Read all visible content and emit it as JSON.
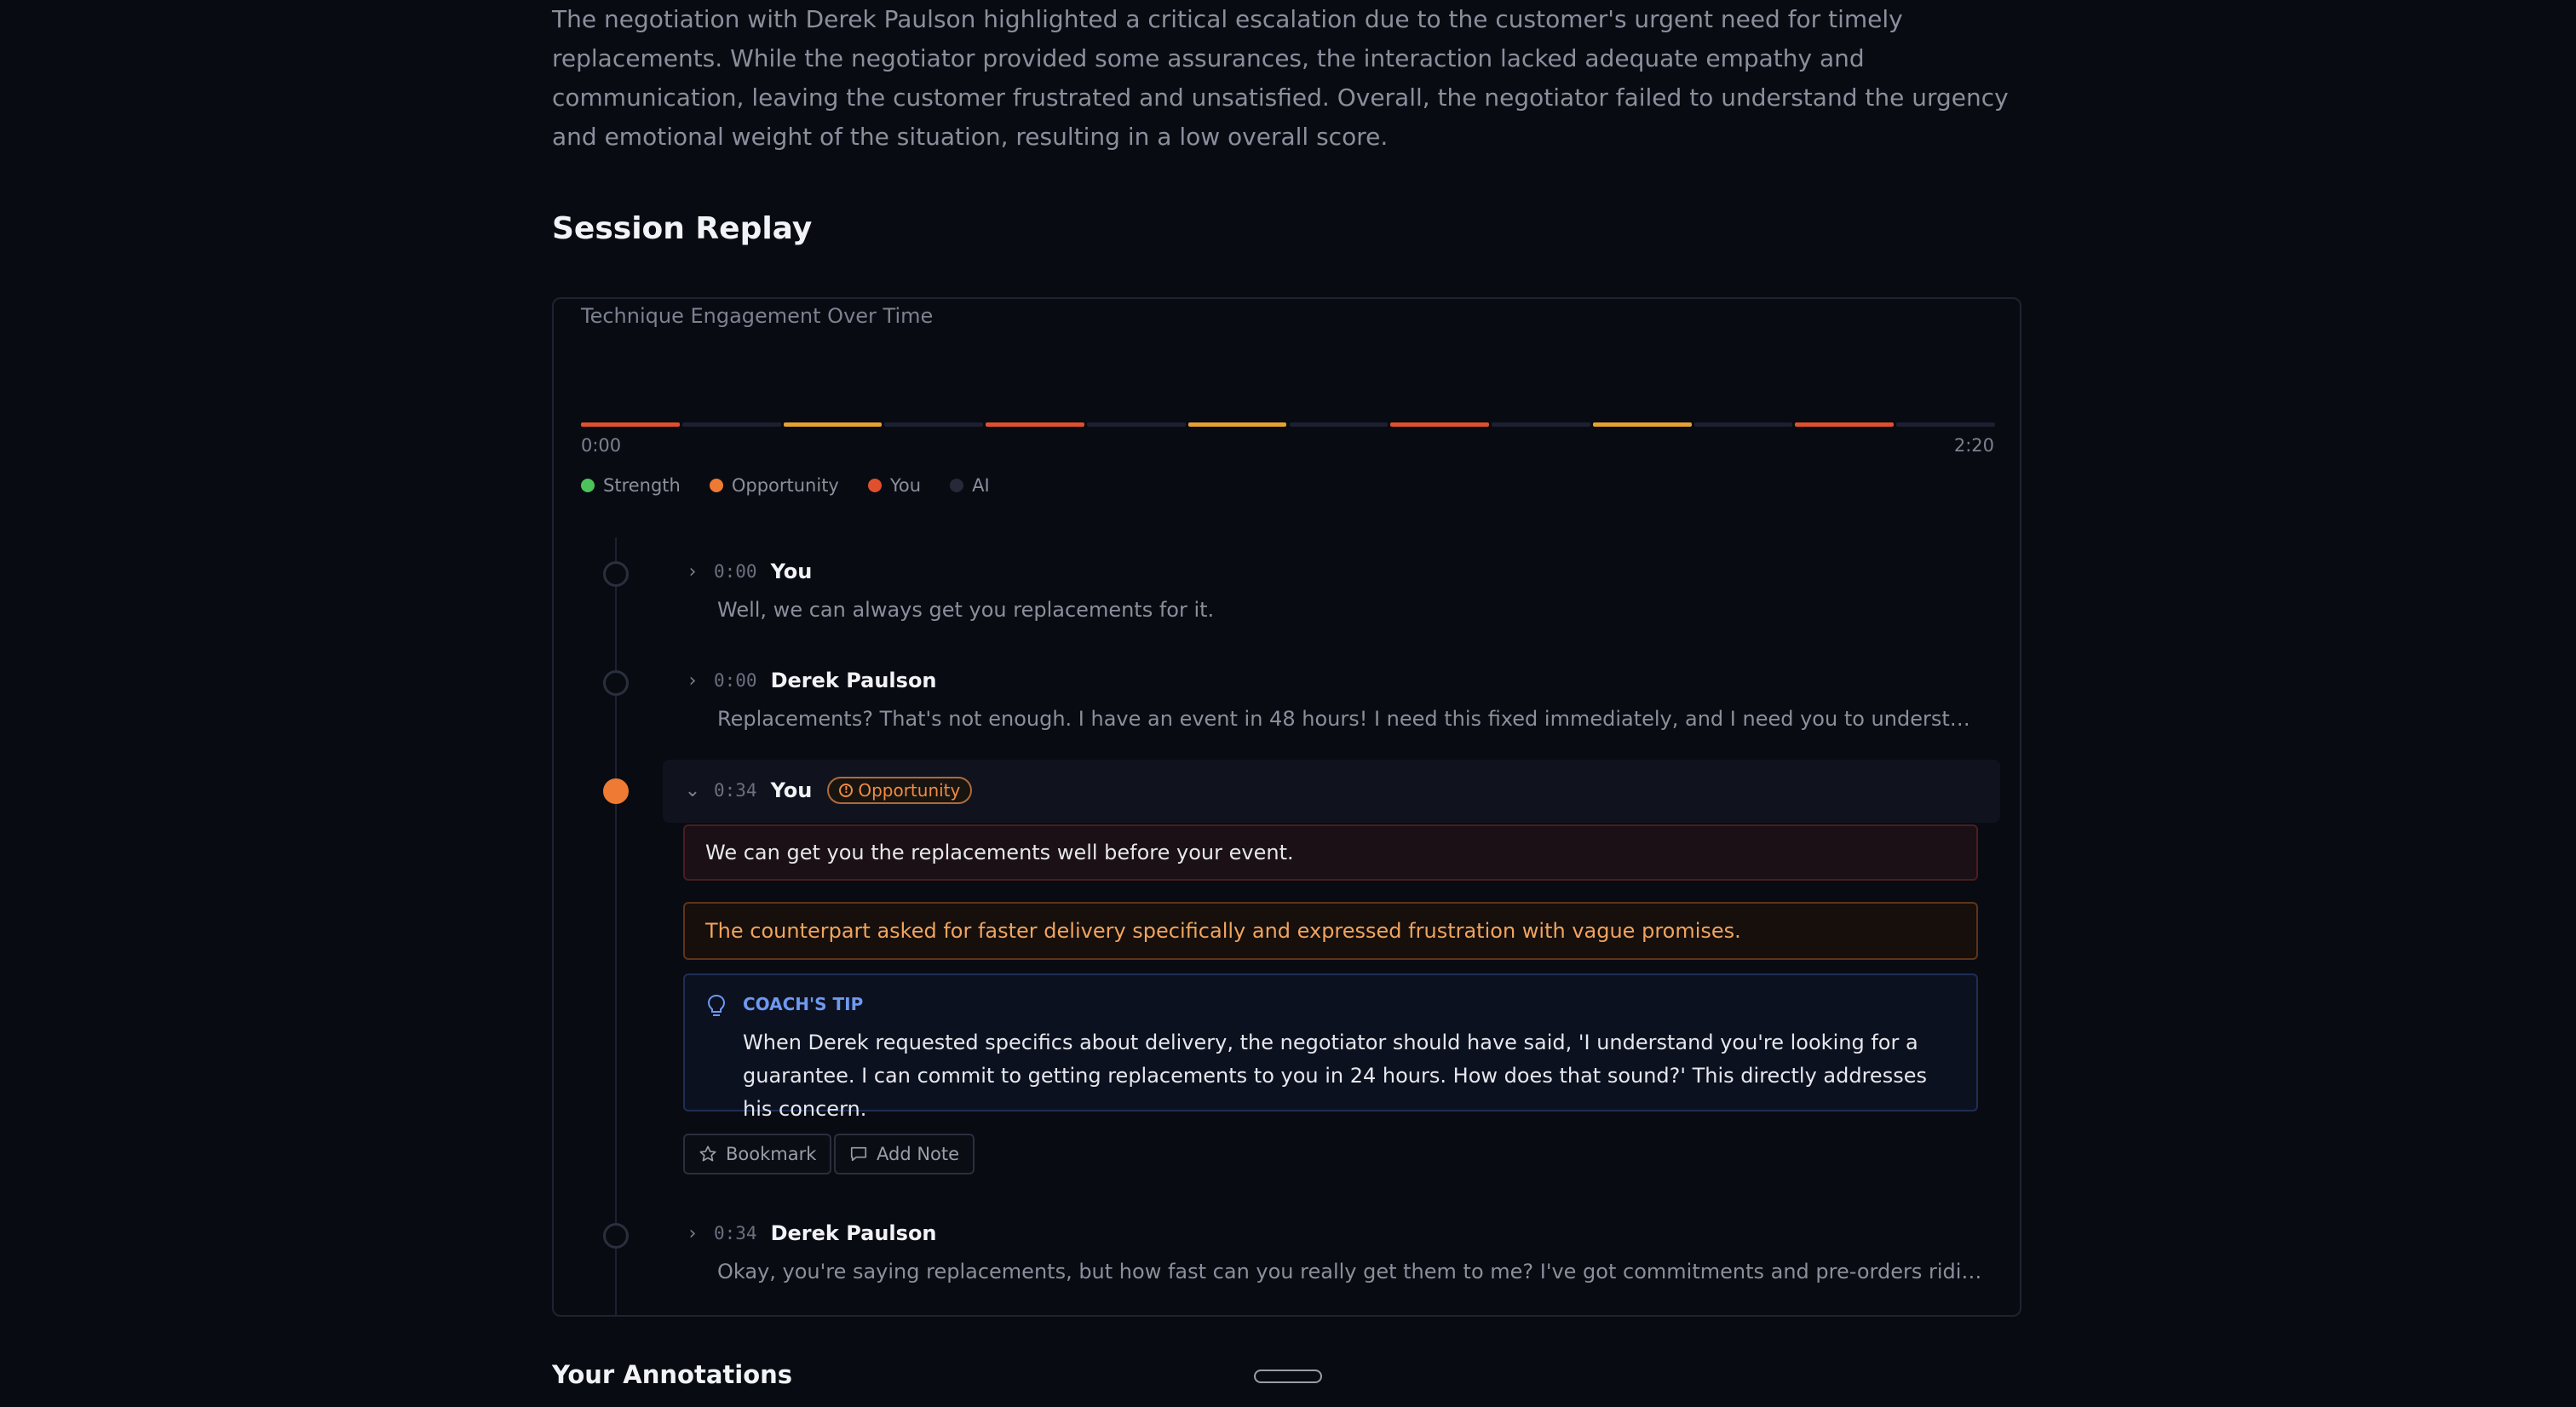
{
  "summary": {
    "text": "The negotiation with Derek Paulson highlighted a critical escalation due to the customer's urgent need for timely replacements. While the negotiator provided some assurances, the interaction lacked adequate empathy and communication, leaving the customer frustrated and unsatisfied. Overall, the negotiator failed to understand the urgency and emotional weight of the situation, resulting in a low overall score."
  },
  "session_replay": {
    "title": "Session Replay",
    "chart": {
      "title": "Technique Engagement Over Time",
      "start_label": "0:00",
      "end_label": "2:20",
      "segments": [
        "red",
        "none",
        "amber",
        "none",
        "red",
        "none",
        "amber",
        "none",
        "red",
        "none",
        "amber",
        "none",
        "red",
        "none"
      ],
      "colors": {
        "red": "#e0502e",
        "amber": "#e6a133",
        "none": "#1c2030"
      },
      "legend": [
        {
          "label": "Strength",
          "color": "#4cc25a"
        },
        {
          "label": "Opportunity",
          "color": "#ef7a33"
        },
        {
          "label": "You",
          "color": "#e0502e"
        },
        {
          "label": "AI",
          "color": "#262a38"
        }
      ]
    },
    "messages": [
      {
        "time": "0:00",
        "speaker": "You",
        "text": "Well, we can always get you replacements for it."
      },
      {
        "time": "0:00",
        "speaker": "Derek Paulson",
        "text": "Replacements? That's not enough. I have an event in 48 hours! I need this fixed immediately, and I need you to understand the mess..."
      },
      {
        "time": "0:34",
        "speaker": "You",
        "badge": "Opportunity",
        "quote": "We can get you the replacements well before your event.",
        "context": "The counterpart asked for faster delivery specifically and expressed frustration with vague promises.",
        "tip_label": "COACH'S TIP",
        "tip": "When Derek requested specifics about delivery, the negotiator should have said, 'I understand you're looking for a guarantee. I can commit to getting replacements to you in 24 hours. How does that sound?' This directly addresses his concern."
      },
      {
        "time": "0:34",
        "speaker": "Derek Paulson",
        "text": "Okay, you're saying replacements, but how fast can you really get them to me? I've got commitments and pre-orders riding on this."
      }
    ],
    "actions": {
      "bookmark": "Bookmark",
      "add_note": "Add Note"
    }
  },
  "annotations": {
    "title": "Your Annotations"
  }
}
